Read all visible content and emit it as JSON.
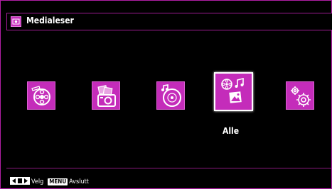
{
  "header": {
    "title": "Medialeser",
    "icon": "media-icon"
  },
  "tiles": [
    {
      "name": "video",
      "icon": "film-reel-icon",
      "selected": false
    },
    {
      "name": "photo",
      "icon": "camera-photo-icon",
      "selected": false
    },
    {
      "name": "music",
      "icon": "music-disc-icon",
      "selected": false
    },
    {
      "name": "all",
      "icon": "all-media-icon",
      "selected": true
    },
    {
      "name": "settings",
      "icon": "gear-icon",
      "selected": false
    }
  ],
  "selected_caption": "Alle",
  "footer": {
    "select_label": "Velg",
    "menu_key": "MENU",
    "exit_label": "Avslutt"
  },
  "colors": {
    "accent": "#c42cba",
    "border": "#b21fa6",
    "background": "#000000"
  }
}
